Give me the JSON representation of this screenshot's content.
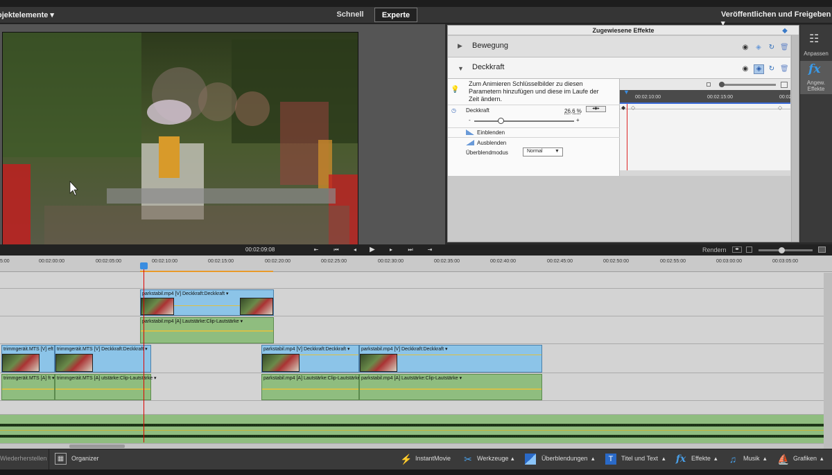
{
  "modebar": {
    "left_menu": "ojektelemente ▾",
    "tab_quick": "Schnell",
    "tab_expert": "Experte",
    "publish": "Veröffentlichen und Freigeben ▾"
  },
  "fx_panel": {
    "title": "Zugewiesene Effekte",
    "effects": [
      {
        "label": "Bewegung",
        "state": "collapsed"
      },
      {
        "label": "Deckkraft",
        "state": "expanded"
      }
    ],
    "hint": "Zum Animieren Schlüsselbilder zu diesen Parametern hinzufügen und diese im Laufe der Zeit ändern.",
    "param_label": "Deckkraft",
    "param_value": "26,6 %",
    "slider_minus": "-",
    "slider_plus": "+",
    "slider_fraction": 0.266,
    "fade_in": "Einblenden",
    "fade_out": "Ausblenden",
    "blend_label": "Überblendmodus",
    "blend_value": "Normal",
    "kf_ticks": [
      "00:02:10:00",
      "00:02:15:00",
      "00:02"
    ]
  },
  "tools": {
    "adjust_label": "Anpassen",
    "fx_label_1": "Angew.",
    "fx_label_2": "Effekte"
  },
  "transport": {
    "timecode": "00:02:09:08",
    "render": "Rendern"
  },
  "timeline": {
    "ticks": [
      "5:00",
      "00:02:00:00",
      "00:02:05:00",
      "00:02:10:00",
      "00:02:15:00",
      "00:02:20:00",
      "00:02:25:00",
      "00:02:30:00",
      "00:02:35:00",
      "00:02:40:00",
      "00:02:45:00",
      "00:02:50:00",
      "00:02:55:00",
      "00:03:00:00",
      "00:03:05:00"
    ],
    "clip_v1": "parkstabil.mp4 [V]   Deckkraft:Deckkraft ▾",
    "clip_a1": "parkstabil.mp4 [A]   Lautstärke:Clip-Lautstärke ▾",
    "clip_v2a": "trimmgeräit.MTS [V]  eft ▾",
    "clip_v2b": "trimmgeräit.MTS [V]   Deckkraft:Deckkraft ▾",
    "clip_a2a": "trimmgeräit.MTS [A]   ft ▾",
    "clip_a2b": "trimmgeräit.MTS [A]   utstärke:Clip-Lautstärke ▾",
    "clip_v3a": "parkstabil.mp4 [V]   Deckkraft:Deckkraft ▾",
    "clip_v3b": "parkstabil.mp4 [V]   Deckkraft:Deckkraft ▾",
    "clip_a3a": "parkstabil.mp4 [A]   Lautstärke:Clip-Lautstärke ▾",
    "clip_a3b": "parkstabil.mp4 [A]   Lautstärke:Clip-Lautstärke ▾"
  },
  "bottombar": {
    "redo": "Wiederherstellen",
    "organizer": "Organizer",
    "instantmovie": "InstantMovie",
    "tools": "Werkzeuge",
    "transitions": "Überblendungen",
    "titles": "Titel und Text",
    "effects": "Effekte",
    "music": "Musik",
    "graphics": "Grafiken"
  }
}
